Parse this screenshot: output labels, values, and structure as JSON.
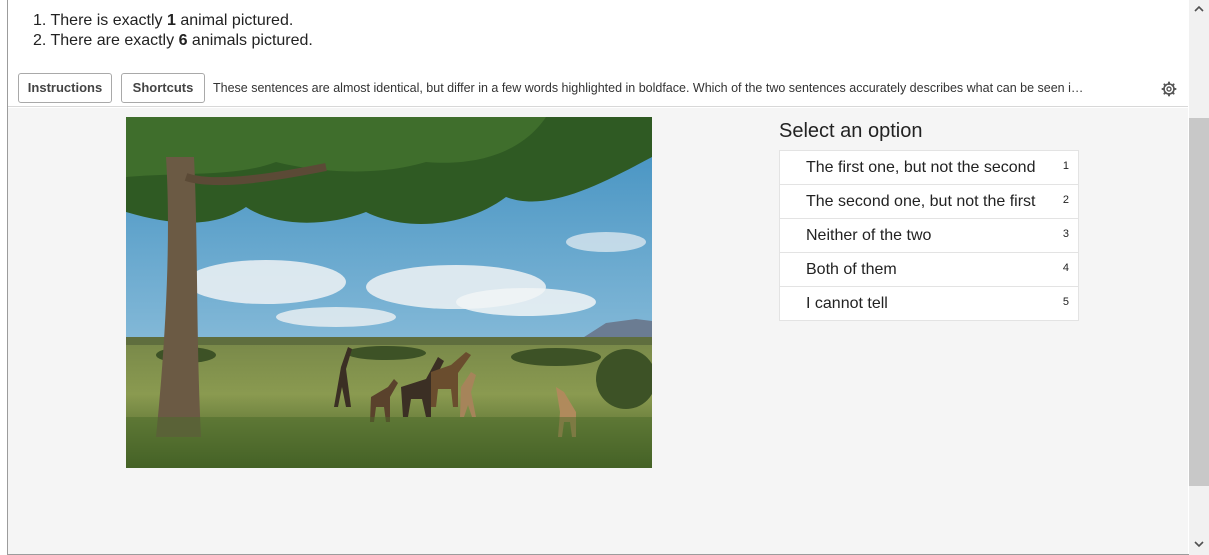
{
  "sentences": [
    {
      "number": "1.",
      "before": "There is exactly ",
      "bold": "1",
      "after": " animal pictured."
    },
    {
      "number": "2.",
      "before": "There are exactly ",
      "bold": "6",
      "after": " animals pictured."
    }
  ],
  "toolbar": {
    "instructions_label": "Instructions",
    "shortcuts_label": "Shortcuts",
    "description": "These sentences are almost identical, but differ in a few words highlighted in boldface. Which of the two sentences accurately describes what can be seen i…",
    "settings_icon": "gear-icon"
  },
  "options_panel": {
    "title": "Select an option",
    "options": [
      {
        "label": "The first one, but not the second",
        "key": "1"
      },
      {
        "label": "The second one, but not the first",
        "key": "2"
      },
      {
        "label": "Neither of the two",
        "key": "3"
      },
      {
        "label": "Both of them",
        "key": "4"
      },
      {
        "label": "I cannot tell",
        "key": "5"
      }
    ]
  },
  "image": {
    "subject": "giraffes under an acacia tree on savanna"
  },
  "scrollbar": {
    "up_icon": "chevron-up-icon",
    "down_icon": "chevron-down-icon"
  }
}
